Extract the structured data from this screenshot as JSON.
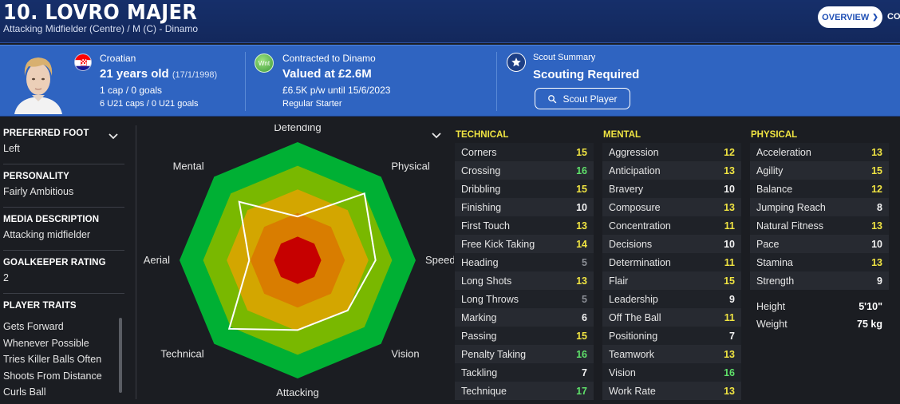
{
  "header": {
    "player_name": "10. LOVRO MAJER",
    "subtitle": "Attacking Midfielder (Centre) / M (C) - Dinamo",
    "overview_label": "OVERVIEW",
    "next_tab_label": "CO"
  },
  "info": {
    "nationality": "Croatian",
    "age": "21 years old",
    "dob": "(17/1/1998)",
    "caps": "1 cap / 0 goals",
    "u21_caps": "6 U21 caps / 0 U21 goals",
    "club_badge_text": "Wnt",
    "contract": "Contracted to Dinamo",
    "value": "Valued at £2.6M",
    "wage": "£6.5K p/w until 15/6/2023",
    "status": "Regular Starter",
    "scout_title": "Scout Summary",
    "scout_status": "Scouting Required",
    "scout_button": "Scout Player"
  },
  "profile": {
    "preferred_foot_label": "PREFERRED FOOT",
    "preferred_foot": "Left",
    "personality_label": "PERSONALITY",
    "personality": "Fairly Ambitious",
    "media_label": "MEDIA DESCRIPTION",
    "media": "Attacking midfielder",
    "gk_rating_label": "GOALKEEPER RATING",
    "gk_rating": "2",
    "traits_label": "PLAYER TRAITS",
    "traits": [
      "Gets Forward",
      "Whenever Possible",
      "Tries Killer Balls Often",
      "Shoots From Distance",
      "Curls Ball"
    ]
  },
  "radar": {
    "labels": [
      "Defending",
      "Physical",
      "Speed",
      "Vision",
      "Attacking",
      "Technical",
      "Aerial",
      "Mental"
    ],
    "values": [
      0.37,
      0.8,
      0.66,
      0.6,
      0.59,
      0.82,
      0.41,
      0.7
    ],
    "band_colors": [
      "#00b034",
      "#79b800",
      "#d3a600",
      "#d97d00",
      "#c60000"
    ]
  },
  "technical": {
    "label": "TECHNICAL",
    "rows": [
      {
        "name": "Corners",
        "value": "15",
        "color": "yellow"
      },
      {
        "name": "Crossing",
        "value": "16",
        "color": "green"
      },
      {
        "name": "Dribbling",
        "value": "15",
        "color": "yellow"
      },
      {
        "name": "Finishing",
        "value": "10",
        "color": "white"
      },
      {
        "name": "First Touch",
        "value": "13",
        "color": "yellow"
      },
      {
        "name": "Free Kick Taking",
        "value": "14",
        "color": "yellow"
      },
      {
        "name": "Heading",
        "value": "5",
        "color": "grey"
      },
      {
        "name": "Long Shots",
        "value": "13",
        "color": "yellow"
      },
      {
        "name": "Long Throws",
        "value": "5",
        "color": "grey"
      },
      {
        "name": "Marking",
        "value": "6",
        "color": "white"
      },
      {
        "name": "Passing",
        "value": "15",
        "color": "yellow"
      },
      {
        "name": "Penalty Taking",
        "value": "16",
        "color": "green"
      },
      {
        "name": "Tackling",
        "value": "7",
        "color": "white"
      },
      {
        "name": "Technique",
        "value": "17",
        "color": "green"
      }
    ]
  },
  "mental": {
    "label": "MENTAL",
    "rows": [
      {
        "name": "Aggression",
        "value": "12",
        "color": "yellow"
      },
      {
        "name": "Anticipation",
        "value": "13",
        "color": "yellow"
      },
      {
        "name": "Bravery",
        "value": "10",
        "color": "white"
      },
      {
        "name": "Composure",
        "value": "13",
        "color": "yellow"
      },
      {
        "name": "Concentration",
        "value": "11",
        "color": "yellow"
      },
      {
        "name": "Decisions",
        "value": "10",
        "color": "white"
      },
      {
        "name": "Determination",
        "value": "11",
        "color": "yellow"
      },
      {
        "name": "Flair",
        "value": "15",
        "color": "yellow"
      },
      {
        "name": "Leadership",
        "value": "9",
        "color": "white"
      },
      {
        "name": "Off The Ball",
        "value": "11",
        "color": "yellow"
      },
      {
        "name": "Positioning",
        "value": "7",
        "color": "white"
      },
      {
        "name": "Teamwork",
        "value": "13",
        "color": "yellow"
      },
      {
        "name": "Vision",
        "value": "16",
        "color": "green"
      },
      {
        "name": "Work Rate",
        "value": "13",
        "color": "yellow"
      }
    ]
  },
  "physical": {
    "label": "PHYSICAL",
    "rows": [
      {
        "name": "Acceleration",
        "value": "13",
        "color": "yellow"
      },
      {
        "name": "Agility",
        "value": "15",
        "color": "yellow"
      },
      {
        "name": "Balance",
        "value": "12",
        "color": "yellow"
      },
      {
        "name": "Jumping Reach",
        "value": "8",
        "color": "white"
      },
      {
        "name": "Natural Fitness",
        "value": "13",
        "color": "yellow"
      },
      {
        "name": "Pace",
        "value": "10",
        "color": "white"
      },
      {
        "name": "Stamina",
        "value": "13",
        "color": "yellow"
      },
      {
        "name": "Strength",
        "value": "9",
        "color": "white"
      }
    ],
    "height_label": "Height",
    "height": "5'10\"",
    "weight_label": "Weight",
    "weight": "75 kg"
  }
}
